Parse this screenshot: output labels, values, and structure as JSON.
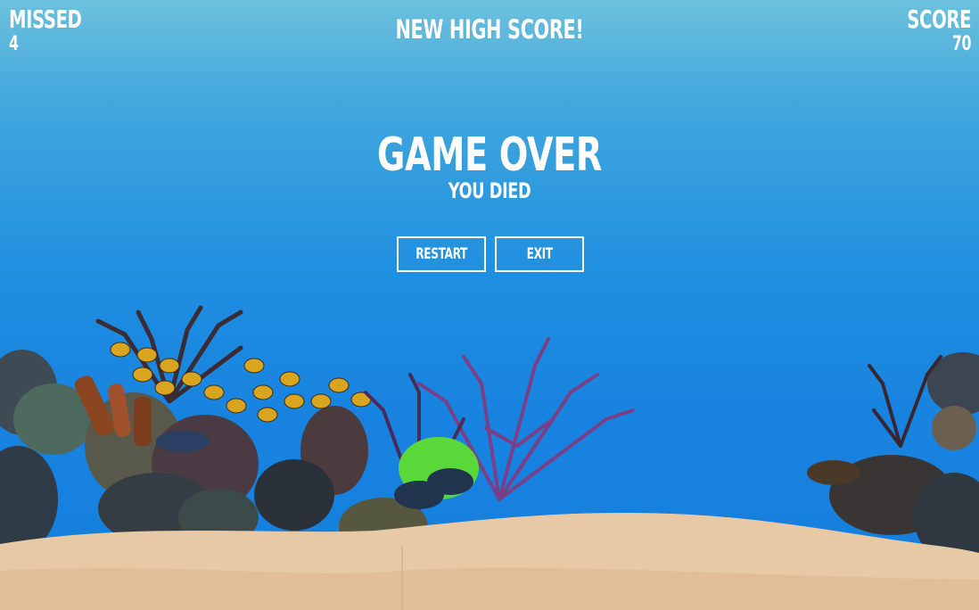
{
  "hud": {
    "missed_label": "MISSED",
    "missed_value": "4",
    "score_label": "SCORE",
    "score_value": "70"
  },
  "banner": "NEW HIGH SCORE!",
  "game_over": {
    "title": "GAME OVER",
    "subtitle": "YOU DIED"
  },
  "buttons": {
    "restart": "RESTART",
    "exit": "EXIT"
  },
  "colors": {
    "water_top": "#6cc1dd",
    "water_bottom": "#167fde",
    "sand": "#e8c9a6",
    "text": "#ffffff"
  }
}
